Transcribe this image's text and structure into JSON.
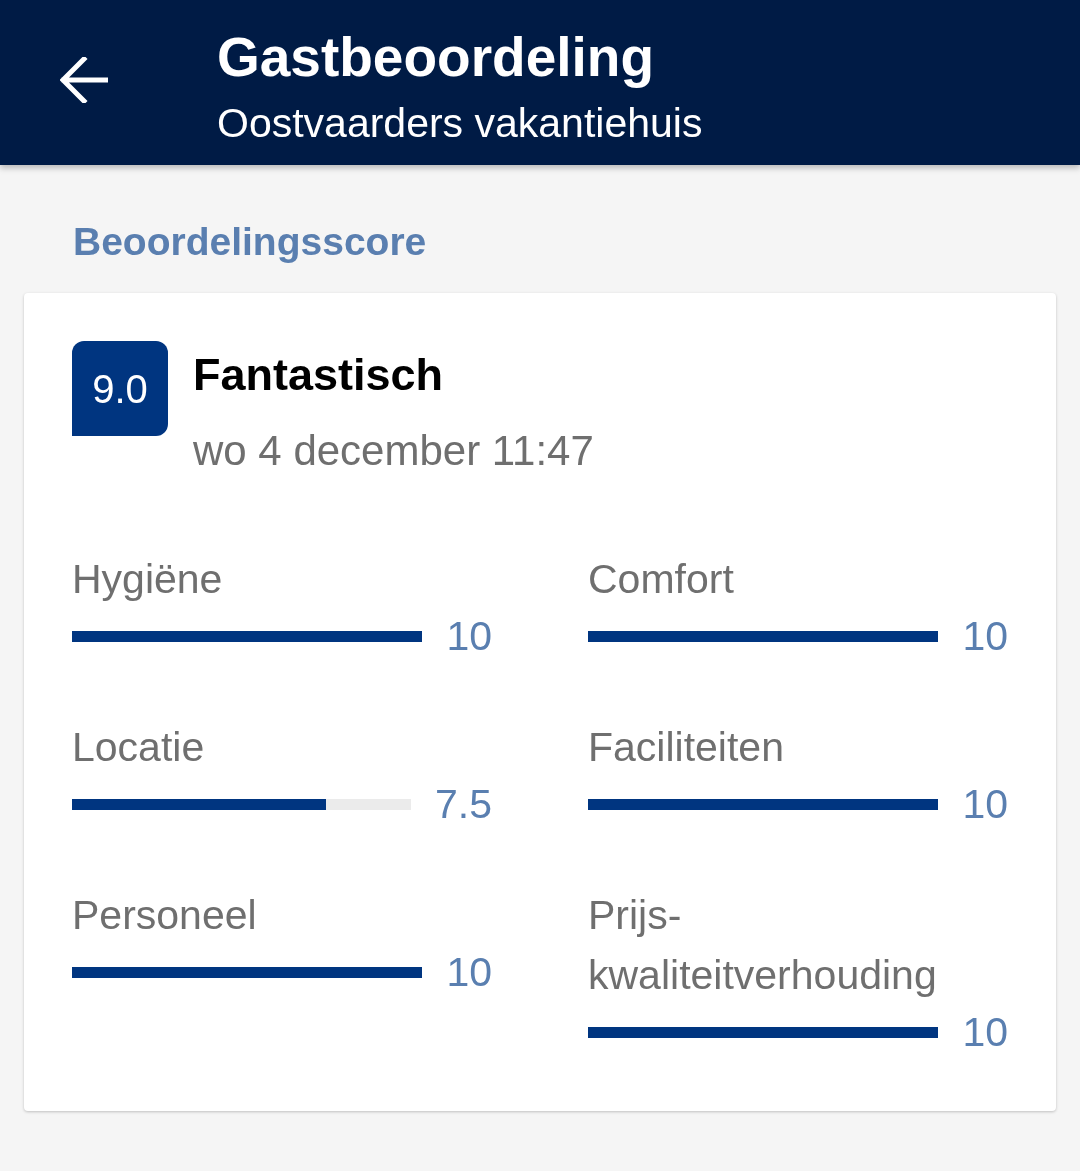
{
  "app_bar": {
    "title": "Gastbeoordeling",
    "subtitle": "Oostvaarders vakantiehuis"
  },
  "section_title": "Beoordelingsscore",
  "review": {
    "score": "9.0",
    "verdict": "Fantastisch",
    "date": "wo 4 december 11:47",
    "categories": [
      {
        "name": "Hygiëne",
        "level": 1,
        "value": "10"
      },
      {
        "name": "Comfort",
        "level": 1,
        "value": "10"
      },
      {
        "name": "Locatie",
        "level": 0.75,
        "value": "7.5"
      },
      {
        "name": "Faciliteiten",
        "level": 1,
        "value": "10"
      },
      {
        "name": "Personeel",
        "level": 1,
        "value": "10"
      },
      {
        "name": "Prijs-kwaliteitverhouding",
        "level": 1,
        "value": "10"
      }
    ]
  }
}
